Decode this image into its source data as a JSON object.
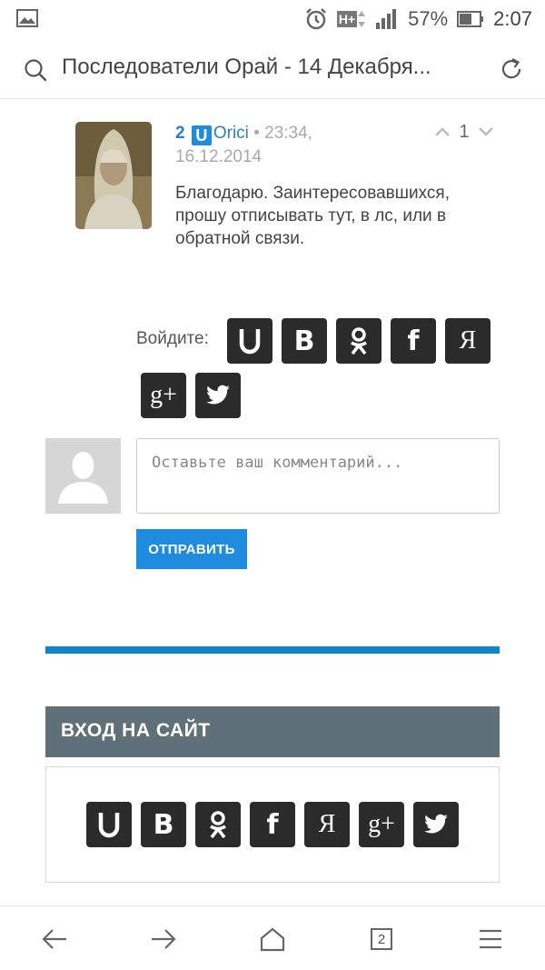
{
  "status_bar": {
    "network": "H+",
    "battery": "57%",
    "time": "2:07"
  },
  "url_bar": {
    "title": "Последователи Орай - 14 Декабря..."
  },
  "comment": {
    "number": "2",
    "badge": "U",
    "author": "Orici",
    "time": "• 23:34, 16.12.2014",
    "vote_count": "1",
    "text": "Благодарю. Заинтересовавшихся, прошу отписывать тут, в лс, или в обратной связи."
  },
  "login": {
    "label": "Войдите:",
    "providers": [
      "U",
      "В",
      "ok",
      "f",
      "Я",
      "g+",
      "twitter"
    ]
  },
  "comment_form": {
    "placeholder": "Оставьте ваш комментарий...",
    "submit_label": "ОТПРАВИТЬ"
  },
  "site_login": {
    "header": "ВХОД НА САЙТ"
  },
  "bottom_nav": {
    "tabs_count": "2"
  },
  "colors": {
    "accent": "#1f8ce0",
    "header_bg": "#607079",
    "social_bg": "#2b2b2b"
  }
}
